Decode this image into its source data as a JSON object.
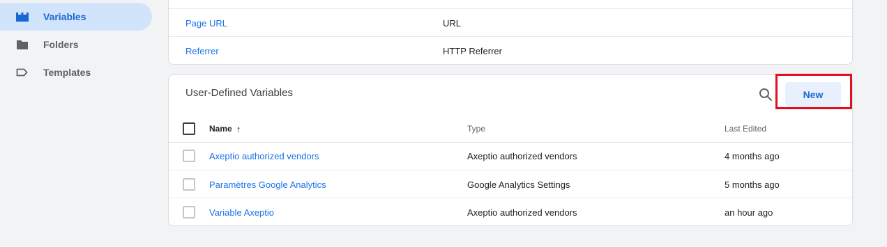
{
  "sidebar": {
    "items": [
      {
        "label": "Variables",
        "icon": "variables-blocks-icon",
        "active": true
      },
      {
        "label": "Folders",
        "icon": "folder-icon",
        "active": false
      },
      {
        "label": "Templates",
        "icon": "tag-icon",
        "active": false
      }
    ]
  },
  "builtin_table": {
    "rows": [
      {
        "name": "Page URL",
        "type": "URL"
      },
      {
        "name": "Referrer",
        "type": "HTTP Referrer"
      }
    ]
  },
  "user_defined": {
    "title": "User-Defined Variables",
    "new_label": "New",
    "columns": {
      "name": "Name",
      "type": "Type",
      "last_edited": "Last Edited"
    },
    "sort_indicator": "↑",
    "rows": [
      {
        "name": "Axeptio authorized vendors",
        "type": "Axeptio authorized vendors",
        "last_edited": "4 months ago"
      },
      {
        "name": "Paramètres Google Analytics",
        "type": "Google Analytics Settings",
        "last_edited": "5 months ago"
      },
      {
        "name": "Variable Axeptio",
        "type": "Axeptio authorized vendors",
        "last_edited": "an hour ago"
      }
    ]
  },
  "colors": {
    "accent": "#1a73e8",
    "active_bg": "#d2e3fc",
    "highlight": "#e0101e"
  }
}
